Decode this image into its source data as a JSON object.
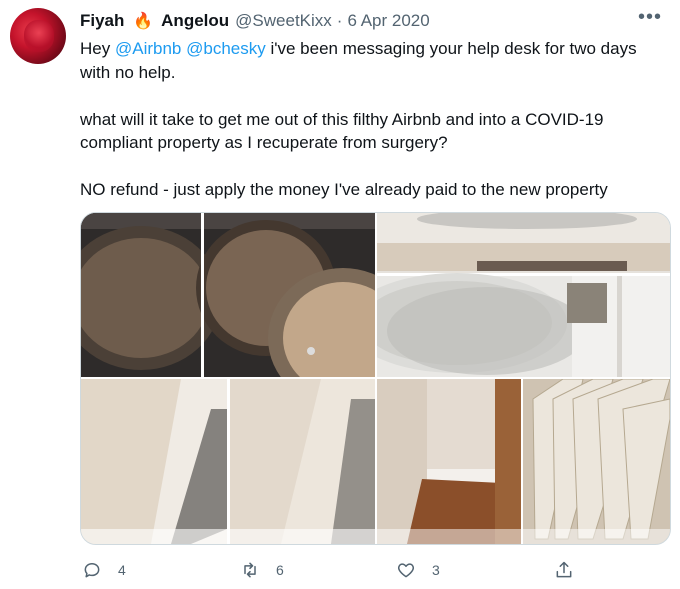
{
  "tweet": {
    "display_name_first": "Fiyah",
    "display_name_last": "Angelou",
    "emoji": "🔥",
    "handle": "@SweetKixx",
    "separator": "·",
    "date": "6 Apr 2020",
    "more": "•••",
    "line1_pre": "Hey ",
    "mention1": "@Airbnb",
    "mention_space": " ",
    "mention2": "@bchesky",
    "line1_post": " i've been messaging your help desk for two days with no help.",
    "paragraph2": "what will it take to get me out of this filthy Airbnb and into a COVID-19 compliant property as I recuperate from surgery?",
    "paragraph3": "NO refund - just apply the money I've already paid to the new property"
  },
  "media": {
    "description_icons": [
      "frying-pans-photo",
      "plates-shelf-photo",
      "wall-corner-photo",
      "floor-corner-photo",
      "blinds-photo"
    ]
  },
  "actions": {
    "reply_count": "4",
    "retweet_count": "6",
    "like_count": "3"
  },
  "colors": {
    "accent": "#1d9bf0",
    "muted": "#536471"
  }
}
